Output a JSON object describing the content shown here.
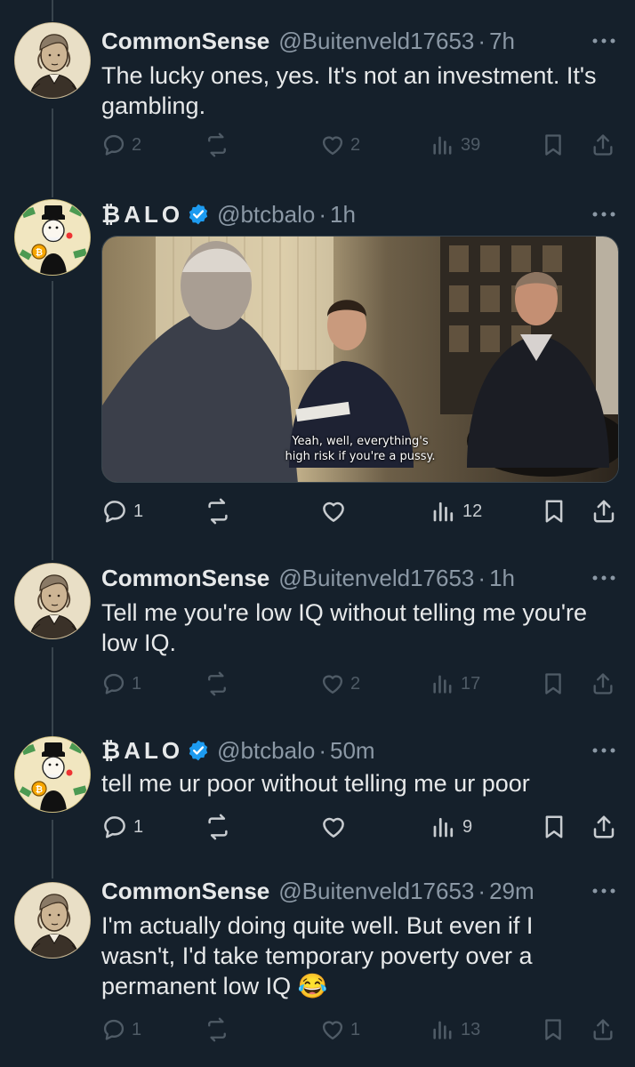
{
  "tweets": [
    {
      "name": "CommonSense",
      "handle": "@Buitenveld17653",
      "dot": "·",
      "time": "7h",
      "text": "The lucky ones, yes. It's not an investment. It's gambling.",
      "replies": "2",
      "reposts": "",
      "likes": "2",
      "views": "39"
    },
    {
      "name": "₿ALO",
      "handle": "@btcbalo",
      "dot": "·",
      "time": "1h",
      "verified": true,
      "media_caption": [
        "Yeah, well, everything's",
        "high risk if you're a pussy."
      ],
      "replies": "1",
      "reposts": "",
      "likes": "",
      "views": "12"
    },
    {
      "name": "CommonSense",
      "handle": "@Buitenveld17653",
      "dot": "·",
      "time": "1h",
      "text": "Tell me you're low IQ without telling me you're low IQ.",
      "replies": "1",
      "reposts": "",
      "likes": "2",
      "views": "17"
    },
    {
      "name": "₿ALO",
      "handle": "@btcbalo",
      "dot": "·",
      "time": "50m",
      "verified": true,
      "text": "tell me ur poor without telling me ur poor",
      "replies": "1",
      "reposts": "",
      "likes": "",
      "views": "9"
    },
    {
      "name": "CommonSense",
      "handle": "@Buitenveld17653",
      "dot": "·",
      "time": "29m",
      "text": "I'm actually doing quite well. But even if I wasn't, I'd take temporary poverty over a permanent low IQ",
      "emoji": "😂",
      "replies": "1",
      "reposts": "",
      "likes": "1",
      "views": "13"
    }
  ],
  "icons": {
    "reply": "reply-icon",
    "repost": "repost-icon",
    "like": "heart-icon",
    "views": "views-icon",
    "bookmark": "bookmark-icon",
    "share": "share-icon",
    "more": "more-icon",
    "verified": "verified-badge-icon"
  },
  "colors": {
    "background": "#15202b",
    "text": "#e7e9ea",
    "secondary": "#8b98a5",
    "verified": "#1d9bf0",
    "thread_line": "#38444d"
  }
}
